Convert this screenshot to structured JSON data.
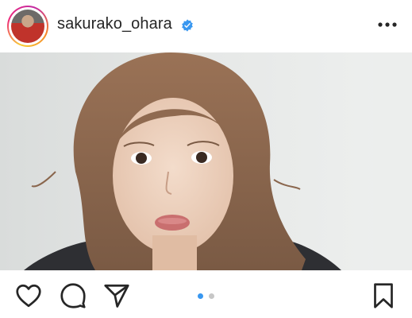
{
  "post": {
    "username": "sakurako_ohara",
    "verified": true
  },
  "carousel": {
    "count": 2,
    "active": 1
  },
  "icons": {
    "avatar": "profile-avatar",
    "verified": "verified-badge-icon",
    "more": "more-options-icon",
    "like": "heart-icon",
    "comment": "comment-bubble-icon",
    "share": "paper-plane-icon",
    "save": "bookmark-icon"
  },
  "colors": {
    "verified_blue": "#3897f0",
    "dot_active": "#3897f0",
    "dot_inactive": "#c7c7c7",
    "text": "#262626"
  }
}
